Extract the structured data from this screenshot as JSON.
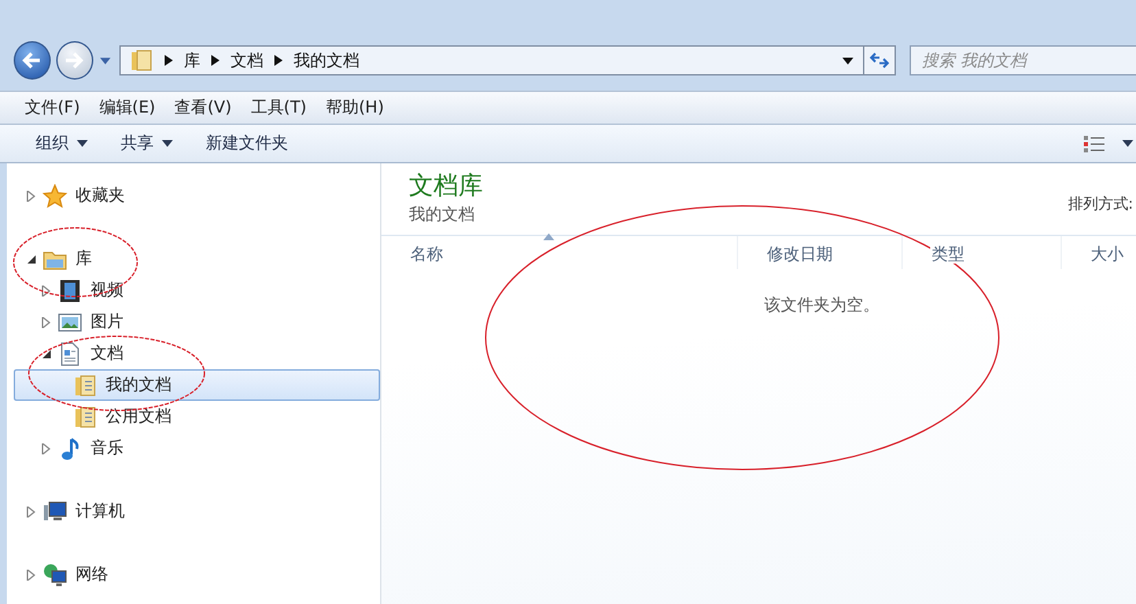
{
  "address_bar": {
    "path": [
      "库",
      "文档",
      "我的文档"
    ],
    "search": {
      "placeholder": "搜索 我的文档"
    }
  },
  "menu_bar": [
    "文件(F)",
    "编辑(E)",
    "查看(V)",
    "工具(T)",
    "帮助(H)"
  ],
  "toolbar": [
    {
      "label": "组织",
      "has_menu": true
    },
    {
      "label": "共享",
      "has_menu": true
    },
    {
      "label": "新建文件夹",
      "has_menu": false
    }
  ],
  "navigation": [
    {
      "group": [
        {
          "label": "收藏夹",
          "kind": "star",
          "expanded": false,
          "selected": false
        }
      ]
    },
    {
      "group": [
        {
          "label": "库",
          "kind": "library",
          "expanded": true,
          "selected": false,
          "children": [
            {
              "label": "视频",
              "kind": "video",
              "expanded": false,
              "selected": false
            },
            {
              "label": "图片",
              "kind": "picture",
              "expanded": false,
              "selected": false
            },
            {
              "label": "文档",
              "kind": "document",
              "expanded": true,
              "selected": false,
              "children": [
                {
                  "label": "我的文档",
                  "kind": "folder",
                  "selected": true
                },
                {
                  "label": "公用文档",
                  "kind": "folder",
                  "selected": false
                }
              ]
            },
            {
              "label": "音乐",
              "kind": "music",
              "expanded": false,
              "selected": false
            }
          ]
        }
      ]
    },
    {
      "group": [
        {
          "label": "计算机",
          "kind": "computer",
          "expanded": false,
          "selected": false
        }
      ]
    },
    {
      "group": [
        {
          "label": "网络",
          "kind": "network",
          "expanded": false,
          "selected": false
        }
      ]
    }
  ],
  "content": {
    "title": "文档库",
    "subtitle": "我的文档",
    "arrange_label": "排列方式:",
    "columns": [
      {
        "label": "名称",
        "sorted": true
      },
      {
        "label": "修改日期",
        "sorted": false
      },
      {
        "label": "类型",
        "sorted": false
      },
      {
        "label": "大小",
        "sorted": false
      }
    ],
    "empty_message": "该文件夹为空。"
  }
}
